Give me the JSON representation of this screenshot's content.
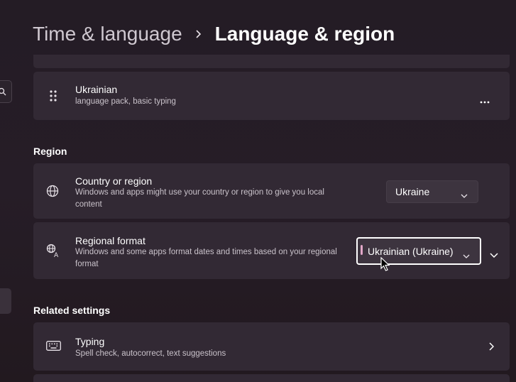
{
  "header": {
    "parent": "Time & language",
    "current": "Language & region"
  },
  "language_item": {
    "name": "Ukrainian",
    "detail": "language pack, basic typing"
  },
  "region": {
    "heading": "Region",
    "country": {
      "title": "Country or region",
      "description": "Windows and apps might use your country or region to give you local content",
      "value": "Ukraine"
    },
    "format": {
      "title": "Regional format",
      "description": "Windows and some apps format dates and times based on your regional format",
      "value": "Ukrainian (Ukraine)"
    }
  },
  "related": {
    "heading": "Related settings",
    "typing": {
      "title": "Typing",
      "description": "Spell check, autocorrect, text suggestions"
    }
  },
  "colors": {
    "background": "#241c25",
    "card": "#322934",
    "accent": "#e2a7c8"
  },
  "icons": [
    "search-icon",
    "chevron-right-icon",
    "drag-handle-icon",
    "more-icon",
    "globe-icon",
    "language-format-icon",
    "chevron-down-icon",
    "keyboard-icon",
    "mouse-cursor-icon"
  ]
}
